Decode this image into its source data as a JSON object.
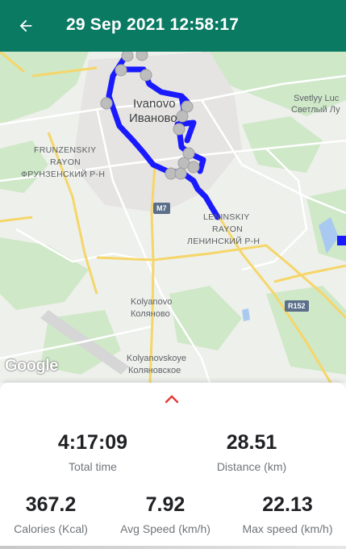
{
  "header": {
    "title": "29 Sep 2021 12:58:17",
    "back_icon": "arrow-left-icon",
    "background_color": "#0a7a63"
  },
  "map": {
    "labels": {
      "city_en": "Ivanovo",
      "city_ru": "Иваново",
      "frunzensky_en_1": "FRUNZENSKIY",
      "frunzensky_en_2": "RAYON",
      "frunzensky_ru": "ФРУНЗЕНСКИЙ Р-Н",
      "leninsky_en_1": "LENINSKIY",
      "leninsky_en_2": "RAYON",
      "leninsky_ru": "ЛЕНИНСКИЙ Р-Н",
      "svetlyy_en": "Svetlyy Luc",
      "svetlyy_ru": "Светлый Лу",
      "kolyanovo_en": "Kolyanovo",
      "kolyanovo_ru": "Колянoво",
      "kolyanovskoye_en": "Kolyanovskoye",
      "kolyanovskoye_ru": "Коляновское"
    },
    "road_shields": {
      "m7": "M7",
      "r152": "R152"
    },
    "attribution": "Google",
    "route_color": "#1a1aff"
  },
  "stats": {
    "total_time": {
      "value": "4:17:09",
      "label": "Total time"
    },
    "distance": {
      "value": "28.51",
      "label": "Distance (km)"
    },
    "calories": {
      "value": "367.2",
      "label": "Calories (Kcal)"
    },
    "avg_speed": {
      "value": "7.92",
      "label": "Avg Speed (km/h)"
    },
    "max_speed": {
      "value": "22.13",
      "label": "Max speed (km/h)"
    }
  },
  "expand_icon": "chevron-up-icon",
  "accent_color": "#e53935"
}
